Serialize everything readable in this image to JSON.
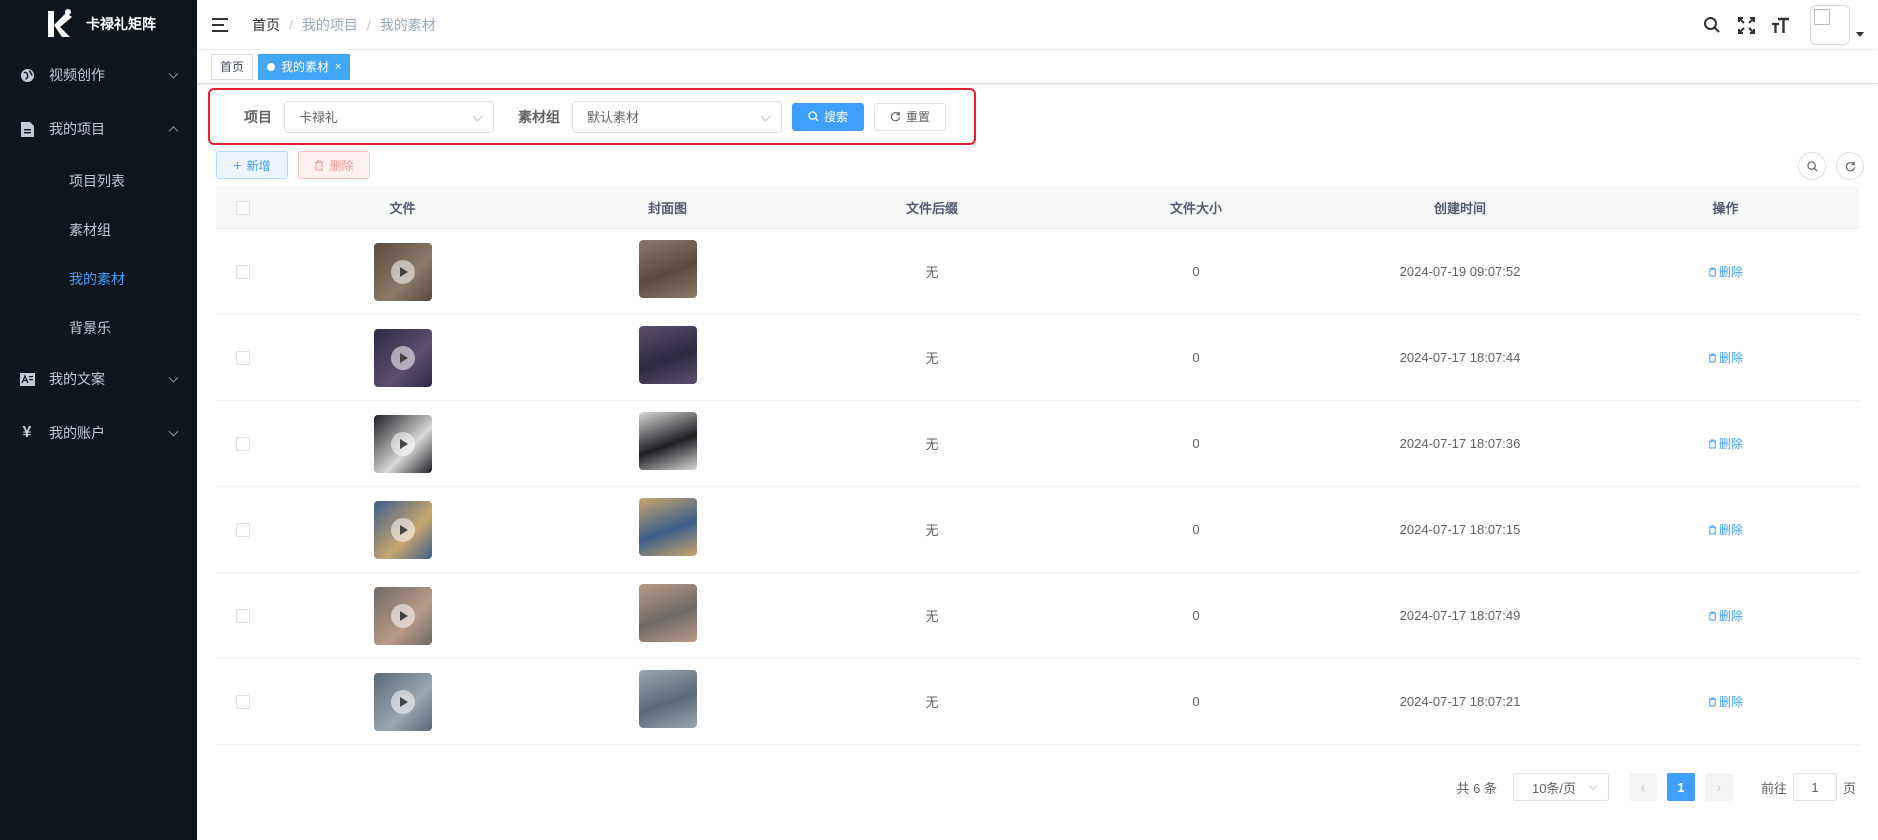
{
  "app": {
    "logo_text": "卡禄礼矩阵"
  },
  "sidebar": {
    "items": [
      {
        "label": "视频创作",
        "icon": "globe-icon",
        "expanded": false
      },
      {
        "label": "我的项目",
        "icon": "document-icon",
        "expanded": true,
        "children": [
          {
            "label": "项目列表",
            "active": false
          },
          {
            "label": "素材组",
            "active": false
          },
          {
            "label": "我的素材",
            "active": true
          },
          {
            "label": "背景乐",
            "active": false
          }
        ]
      },
      {
        "label": "我的文案",
        "icon": "text-image-icon",
        "expanded": false
      },
      {
        "label": "我的账户",
        "icon": "yen-icon",
        "expanded": false
      }
    ]
  },
  "header": {
    "breadcrumb": [
      "首页",
      "我的项目",
      "我的素材"
    ],
    "icons": [
      "search-icon",
      "fullscreen-icon",
      "font-size-icon"
    ]
  },
  "tags": [
    {
      "label": "首页",
      "active": false
    },
    {
      "label": "我的素材",
      "active": true,
      "close": "×"
    }
  ],
  "search": {
    "project_label": "项目",
    "project_value": "卡禄礼",
    "group_label": "素材组",
    "group_value": "默认素材",
    "search_button": "搜索",
    "reset_button": "重置"
  },
  "toolbar": {
    "add_label": "新增",
    "delete_label": "删除"
  },
  "table": {
    "headers": [
      "文件",
      "封面图",
      "文件后缀",
      "文件大小",
      "创建时间",
      "操作"
    ],
    "rows": [
      {
        "ext": "无",
        "size": "0",
        "time": "2024-07-19 09:07:52",
        "op": "删除",
        "colors": [
          "#5a4a3e",
          "#8a7a6a"
        ]
      },
      {
        "ext": "无",
        "size": "0",
        "time": "2024-07-17 18:07:44",
        "op": "删除",
        "colors": [
          "#2e2a40",
          "#5c4e6e"
        ]
      },
      {
        "ext": "无",
        "size": "0",
        "time": "2024-07-17 18:07:36",
        "op": "删除",
        "colors": [
          "#1e1e24",
          "#d8d8d8"
        ]
      },
      {
        "ext": "无",
        "size": "0",
        "time": "2024-07-17 18:07:15",
        "op": "删除",
        "colors": [
          "#3d5f8a",
          "#c7a56e"
        ]
      },
      {
        "ext": "无",
        "size": "0",
        "time": "2024-07-17 18:07:49",
        "op": "删除",
        "colors": [
          "#6e6a66",
          "#b89a88"
        ]
      },
      {
        "ext": "无",
        "size": "0",
        "time": "2024-07-17 18:07:21",
        "op": "删除",
        "colors": [
          "#5a6a78",
          "#9aa6b0"
        ]
      }
    ]
  },
  "pagination": {
    "total": "共 6 条",
    "page_size": "10条/页",
    "current": "1",
    "goto_label": "前往",
    "goto_value": "1",
    "page_suffix": "页"
  },
  "colors": {
    "accent": "#409eff",
    "sidebar_bg": "#0f151d",
    "highlight_border": "#e5202e"
  }
}
